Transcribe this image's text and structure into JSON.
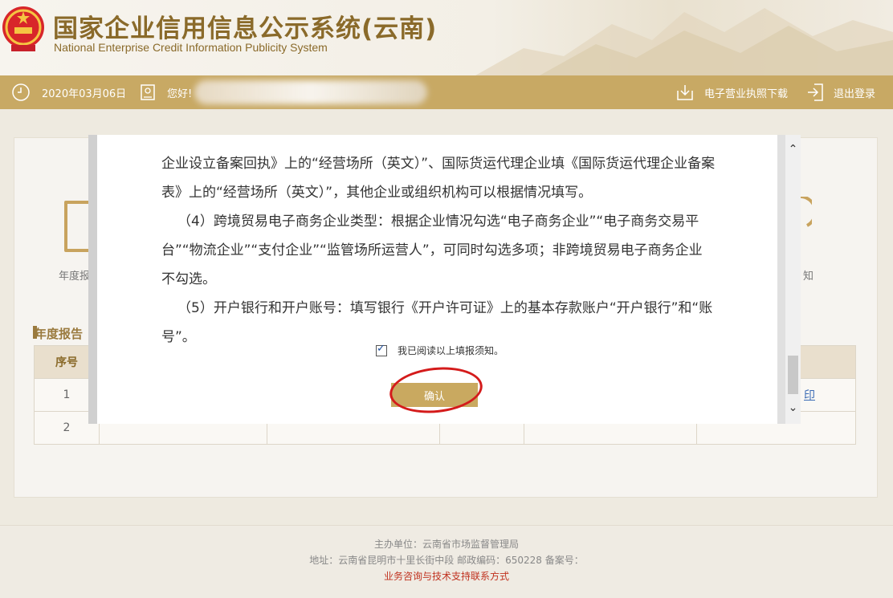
{
  "header": {
    "title_cn": "国家企业信用信息公示系统(云南)",
    "title_en": "National Enterprise Credit Information Publicity System"
  },
  "toolbar": {
    "date": "2020年03月06日",
    "greeting": "您好!",
    "download_license": "电子营业执照下载",
    "logout": "退出登录"
  },
  "background": {
    "annual_label_partial": "年度报",
    "notice_label_partial": "知",
    "section_title_partial": "年度报告",
    "table_header_index": "序号",
    "rows": [
      {
        "index": "1",
        "link_partial": "印"
      },
      {
        "index": "2"
      }
    ]
  },
  "modal": {
    "paragraphs": [
      "企业设立备案回执》上的“经营场所（英文）”、国际货运代理企业填《国际货运代理企业备案表》上的“经营场所（英文）”，其他企业或组织机构可以根据情况填写。",
      "（4）跨境贸易电子商务企业类型：根据企业情况勾选“电子商务企业”“电子商务交易平台”“物流企业”“支付企业”“监管场所运营人”，可同时勾选多项；非跨境贸易电子商务企业不勾选。",
      "（5）开户银行和开户账号：填写银行《开户许可证》上的基本存款账户“开户银行”和“账号”。"
    ],
    "checkbox_label": "我已阅读以上填报须知。",
    "checkbox_checked": true,
    "confirm_label": "确认"
  },
  "footer": {
    "host": "主办单位：云南省市场监督管理局",
    "address": "地址：云南省昆明市十里长街中段 邮政编码：650228 备案号：",
    "support_link": "业务咨询与技术支持联系方式"
  },
  "colors": {
    "gold": "#c8a964",
    "brown_title": "#8a6a2a",
    "annotation_red": "#d41b1b"
  }
}
